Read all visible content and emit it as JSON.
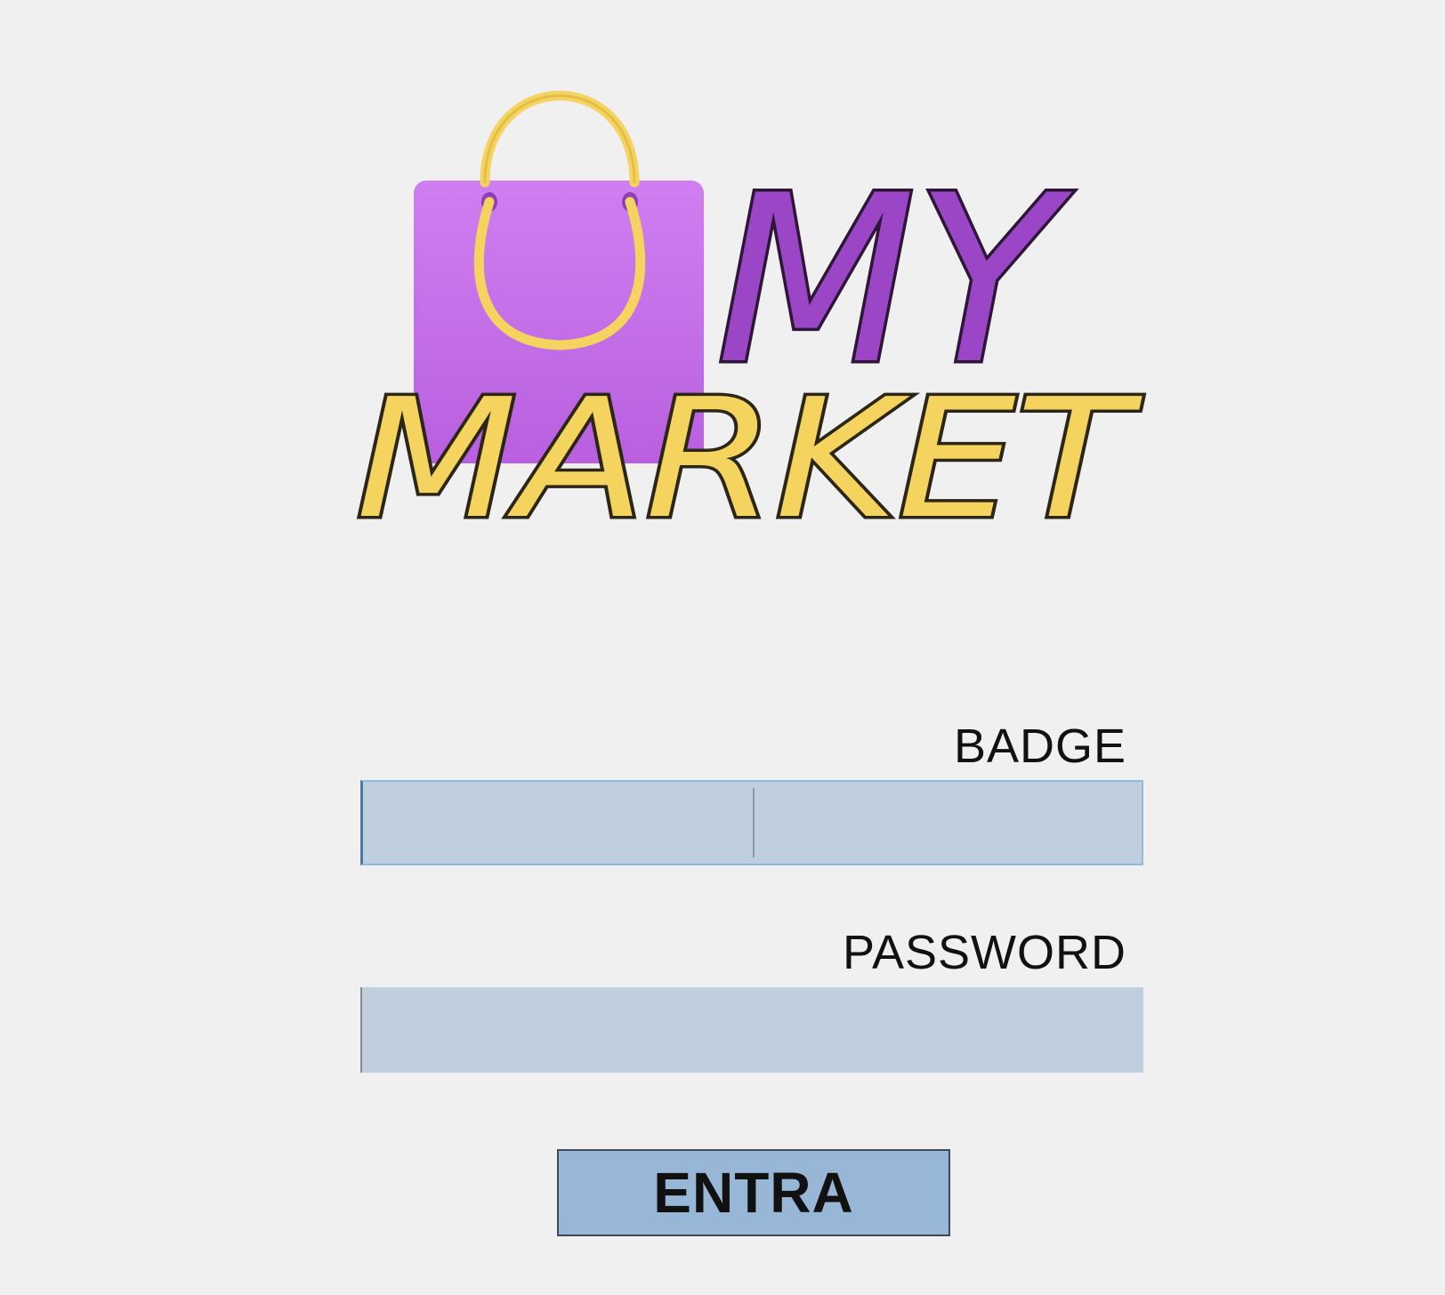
{
  "logo": {
    "word_top": "MY",
    "word_bottom": "MARKET",
    "bag_color": "#c56fe8",
    "accent_yellow": "#f4d35e",
    "accent_purple": "#9a46c6"
  },
  "form": {
    "badge_label": "BADGE",
    "badge_value": "",
    "password_label": "PASSWORD",
    "password_value": "",
    "submit_label": "ENTRA"
  }
}
